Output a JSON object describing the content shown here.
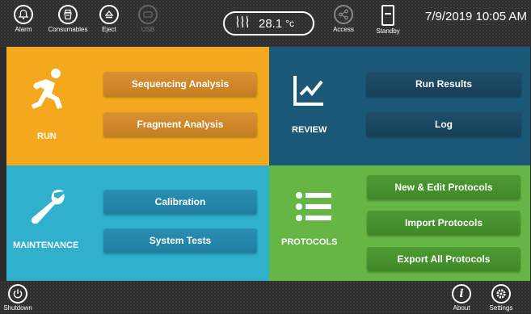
{
  "topbar": {
    "buttons": [
      {
        "label": "Alarm",
        "icon": "bell-icon"
      },
      {
        "label": "Consumables",
        "icon": "consumables-icon"
      },
      {
        "label": "Eject",
        "icon": "eject-icon"
      },
      {
        "label": "USB",
        "icon": "usb-icon"
      },
      {
        "label": "Access",
        "icon": "share-icon"
      },
      {
        "label": "Standby",
        "icon": "standby-icon"
      }
    ],
    "temperature": {
      "value": "28.1",
      "unit": "°c"
    },
    "datetime": "7/9/2019 10:05 AM"
  },
  "tiles": {
    "run": {
      "label": "RUN",
      "color": "#f3a81d",
      "buttons": [
        "Sequencing Analysis",
        "Fragment Analysis"
      ]
    },
    "review": {
      "label": "REVIEW",
      "color": "#1b5878",
      "buttons": [
        "Run Results",
        "Log"
      ]
    },
    "maintenance": {
      "label": "MAINTENANCE",
      "color": "#2fb0cc",
      "buttons": [
        "Calibration",
        "System Tests"
      ]
    },
    "protocols": {
      "label": "PROTOCOLS",
      "color": "#66b646",
      "buttons": [
        "New & Edit Protocols",
        "Import Protocols",
        "Export All Protocols"
      ]
    }
  },
  "bottombar": {
    "shutdown": "Shutdown",
    "about": "About",
    "settings": "Settings"
  }
}
